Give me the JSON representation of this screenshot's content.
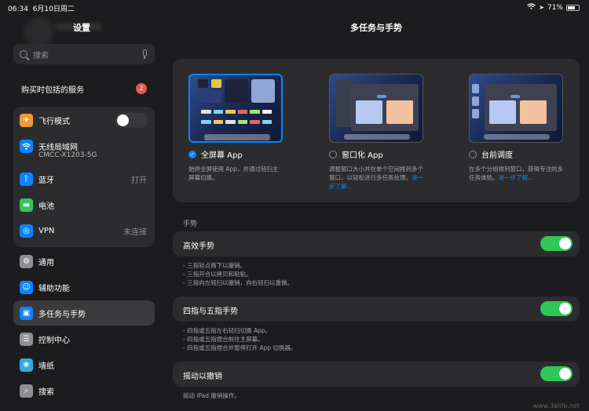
{
  "status": {
    "time": "06:34",
    "date": "6月10日周二",
    "battery": "71%",
    "battery_fraction": 0.71
  },
  "sidebar": {
    "title": "设置",
    "search_placeholder": "搜索",
    "purchase_label": "购买时包括的服务",
    "purchase_badge": "2",
    "airplane": {
      "label": "飞行模式",
      "on": false
    },
    "wifi": {
      "label": "无线局域网",
      "value": "CMCC-X1203-5G"
    },
    "bluetooth": {
      "label": "蓝牙",
      "value": "打开"
    },
    "battery": {
      "label": "电池"
    },
    "vpn": {
      "label": "VPN",
      "value": "未连接"
    },
    "general": {
      "label": "通用"
    },
    "accessibility": {
      "label": "辅助功能"
    },
    "multitask": {
      "label": "多任务与手势"
    },
    "control_center": {
      "label": "控制中心"
    },
    "wallpaper": {
      "label": "墙纸"
    },
    "search": {
      "label": "搜索"
    }
  },
  "main": {
    "title": "多任务与手势",
    "modes": [
      {
        "label": "全屏幕 App",
        "selected": true,
        "desc": "始终全屏使用 App，并通过轻扫主屏幕切换。",
        "link": ""
      },
      {
        "label": "窗口化 App",
        "selected": false,
        "desc": "调整窗口大小并在单个空间排列多个窗口，以轻松进行多任务处理。",
        "link": "进一步了解..."
      },
      {
        "label": "台前调度",
        "selected": false,
        "desc": "在多个分组排列窗口，获得专注的多任务体验。",
        "link": "进一步了解..."
      }
    ],
    "gestures_header": "手势",
    "efficient": {
      "label": "高效手势",
      "on": true,
      "notes": [
        "- 三指轻点两下以撤销。",
        "- 三指开合以拷贝和粘贴。",
        "- 三指向左轻扫以撤销，向右轻扫以重做。"
      ]
    },
    "four_five": {
      "label": "四指与五指手势",
      "on": true,
      "notes": [
        "- 四指或五指左右轻扫切换 App。",
        "- 四指或五指捏合前往主屏幕。",
        "- 四指或五指捏合并暂停打开 App 切换器。"
      ]
    },
    "shake": {
      "label": "摇动以撤销",
      "on": true,
      "note": "摇动 iPad 撤销操作。"
    }
  },
  "watermark": "www.3elife.net",
  "colors": {
    "accent": "#0a84ff",
    "toggle_on": "#30c759",
    "badge": "#e0594c"
  }
}
